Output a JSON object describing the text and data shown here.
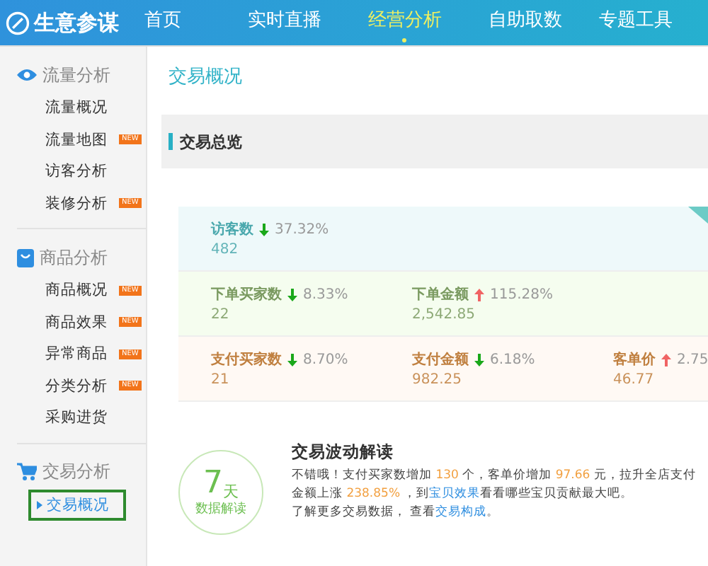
{
  "header": {
    "logo": "生意参谋",
    "nav": [
      {
        "label": "首页",
        "selected": false
      },
      {
        "label": "实时直播",
        "selected": false
      },
      {
        "label": "经营分析",
        "selected": true
      },
      {
        "label": "自助取数",
        "selected": false
      },
      {
        "label": "专题工具",
        "selected": false
      }
    ]
  },
  "sidebar": {
    "groups": [
      {
        "title": "流量分析",
        "items": [
          {
            "label": "流量概况",
            "selected": false
          },
          {
            "label": "流量地图",
            "badge": "NEW",
            "selected": false
          },
          {
            "label": "访客分析",
            "selected": false
          },
          {
            "label": "装修分析",
            "badge": "NEW",
            "selected": false
          }
        ]
      },
      {
        "title": "商品分析",
        "items": [
          {
            "label": "商品概况",
            "badge": "NEW",
            "selected": false
          },
          {
            "label": "商品效果",
            "badge": "NEW",
            "selected": false
          },
          {
            "label": "异常商品",
            "badge": "NEW",
            "selected": false
          },
          {
            "label": "分类分析",
            "badge": "NEW",
            "selected": false
          },
          {
            "label": "采购进货",
            "selected": false
          }
        ]
      },
      {
        "title": "交易分析",
        "items": [
          {
            "label": "交易概况",
            "selected": true
          }
        ]
      }
    ]
  },
  "main": {
    "title": "交易概况",
    "section": "交易总览",
    "stat_rows": [
      {
        "color": "#eef9fa",
        "items": [
          {
            "label": "访客数",
            "kind": "down",
            "change": "37.32%",
            "value": "482"
          }
        ]
      },
      {
        "color": "#f5fdef",
        "items": [
          {
            "label": "下单买家数",
            "kind": "down",
            "change": "8.33%",
            "value": "22"
          },
          {
            "label": "下单金额",
            "kind": "up",
            "change": "115.28%",
            "value": "2,542.85"
          }
        ]
      },
      {
        "color": "#fff9f4",
        "items": [
          {
            "label": "支付买家数",
            "kind": "down",
            "change": "8.70%",
            "value": "21"
          },
          {
            "label": "支付金额",
            "kind": "down",
            "change": "6.18%",
            "value": "982.25"
          },
          {
            "label": "客单价",
            "kind": "up",
            "change": "2.75",
            "value": "46.77"
          }
        ]
      }
    ],
    "insight": {
      "badge_number": "7",
      "badge_unit": "天",
      "badge_caption": "数据解读",
      "title": "交易波动解读",
      "lines": [
        [
          {
            "kind": "plain",
            "text": "不错哦！支付买家数增加 "
          },
          {
            "kind": "highlight",
            "text": "130"
          },
          {
            "kind": "plain",
            "text": " 个，客单价增加 "
          },
          {
            "kind": "highlight",
            "text": "97.66"
          },
          {
            "kind": "plain",
            "text": " 元，拉升全店支付金额上涨 "
          },
          {
            "kind": "highlight",
            "text": "238.85%"
          },
          {
            "kind": "plain",
            "text": " ，到"
          },
          {
            "kind": "link",
            "text": "宝贝效果"
          },
          {
            "kind": "plain",
            "text": "看看哪些宝贝贡献最大吧。"
          }
        ],
        [
          {
            "kind": "plain",
            "text": "了解更多交易数据， 查看"
          },
          {
            "kind": "link",
            "text": "交易构成"
          },
          {
            "kind": "plain",
            "text": "。"
          }
        ]
      ]
    }
  }
}
